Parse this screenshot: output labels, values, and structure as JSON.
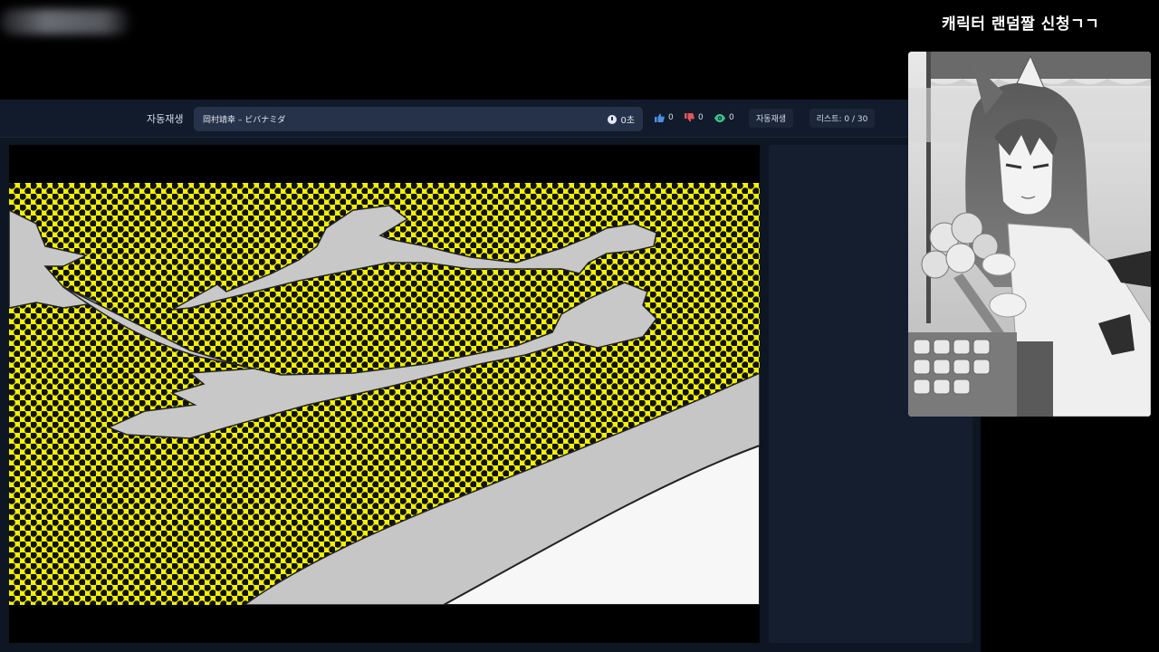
{
  "overlay": {
    "title": "캐릭터 랜덤짤 신청ㄱㄱ"
  },
  "toolbar": {
    "autoplay_label": "자동재생",
    "song_title": "岡村靖幸 – ビバナミダ",
    "timer": "0초",
    "likes": "0",
    "dislikes": "0",
    "views": "0",
    "autoplay_button": "자동재생",
    "list_counter": "리스트: 0 / 30"
  },
  "icons": {
    "timer": "clock-icon",
    "likes": "thumbs-up-icon",
    "dislikes": "thumbs-down-icon",
    "views": "eye-icon"
  },
  "colors": {
    "likes": "#4a90e2",
    "dislikes": "#e2555a",
    "views": "#3fc28a",
    "halftone_bg": "#f2f200"
  }
}
